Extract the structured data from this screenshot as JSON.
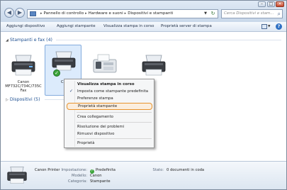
{
  "address_bar": {
    "crumbs": [
      "Pannello di controllo",
      "Hardware e suoni",
      "Dispositivi e stampanti"
    ],
    "search_placeholder": "Cerca Dispositivi e stam..."
  },
  "toolbar": {
    "add_device": "Aggiungi dispositivo",
    "add_printer": "Aggiungi stampante",
    "view_print_queue": "Visualizza stampa in corso",
    "print_server_properties": "Proprietà server di stampa",
    "help": "?"
  },
  "groups": {
    "printers": {
      "label": "Stampanti e fax (4)"
    },
    "devices": {
      "label": "Dispositivi (5)"
    }
  },
  "devices": {
    "fax": {
      "label": "Canon MF732C/734C/735C Fax"
    },
    "printer": {
      "label": "Canon"
    }
  },
  "context_menu": {
    "items": [
      "Visualizza stampa in corso",
      "Imposta come stampante predefinita",
      "Preferenze stampa",
      "Proprietà stampante",
      "Crea collegamento",
      "Risoluzione dei problemi",
      "Rimuovi dispositivo",
      "Proprietà"
    ]
  },
  "details": {
    "name": "Canon Printer",
    "status_key": "Impostazione:",
    "status_value": "Predefinita",
    "model_key": "Modello:",
    "model_value": "Canon",
    "category_key": "Categoria:",
    "category_value": "Stampante",
    "state_key": "Stato:",
    "state_value": "0 documenti in coda"
  }
}
